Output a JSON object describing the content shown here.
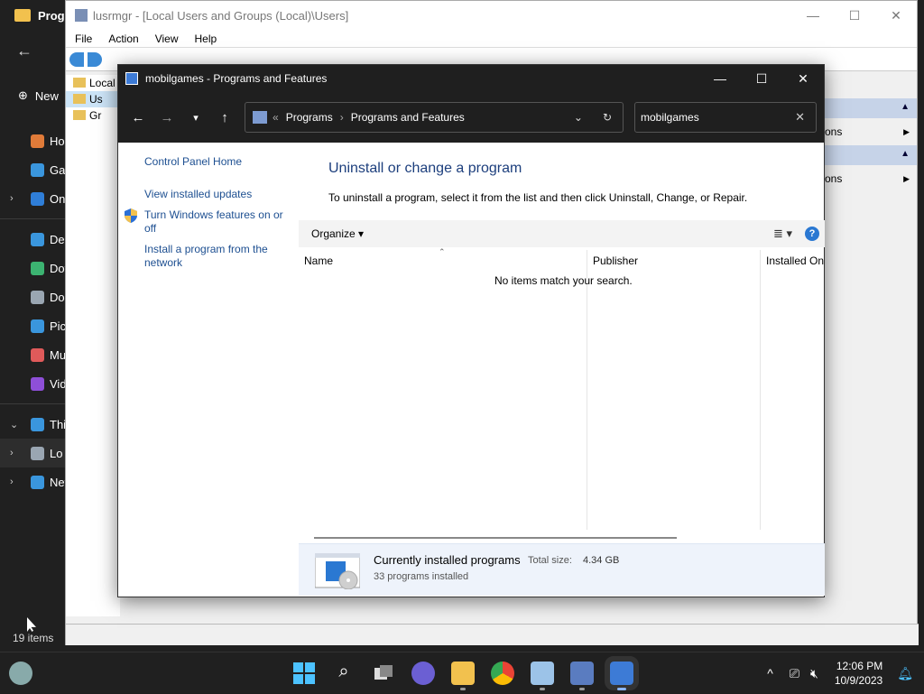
{
  "explorer": {
    "title": "Progr",
    "new_label": "New",
    "nav": [
      {
        "label": "Ho",
        "icon": "home-icon",
        "color": "#e07b39"
      },
      {
        "label": "Gal",
        "icon": "gallery-icon",
        "color": "#3a96dd"
      },
      {
        "label": "On",
        "icon": "onedrive-icon",
        "color": "#2f7ed8",
        "chevron": true
      },
      {
        "label": "Des",
        "icon": "desktop-icon",
        "color": "#3a96dd"
      },
      {
        "label": "Dov",
        "icon": "download-icon",
        "color": "#3cb371"
      },
      {
        "label": "Doc",
        "icon": "documents-icon",
        "color": "#9aa6b2"
      },
      {
        "label": "Pic",
        "icon": "pictures-icon",
        "color": "#3a96dd"
      },
      {
        "label": "Mu",
        "icon": "music-icon",
        "color": "#e05a5a"
      },
      {
        "label": "Vid",
        "icon": "videos-icon",
        "color": "#8e4fd8"
      },
      {
        "label": "Thi",
        "icon": "this-pc-icon",
        "color": "#3a96dd",
        "chevron": "down"
      },
      {
        "label": "Lo",
        "icon": "local-disk-icon",
        "color": "#9aa6b2",
        "chevron": true,
        "selected": true
      },
      {
        "label": "Net",
        "icon": "network-icon",
        "color": "#3a96dd",
        "chevron": true
      }
    ],
    "status": "19 items"
  },
  "lusrmgr": {
    "title": "lusrmgr - [Local Users and Groups (Local)\\Users]",
    "menu": [
      "File",
      "Action",
      "View",
      "Help"
    ],
    "tree": [
      "Local",
      "Us",
      "Gr"
    ],
    "actions": [
      "ons",
      "ons"
    ]
  },
  "pf": {
    "title": "mobilgames - Programs and Features",
    "breadcrumb": [
      "Programs",
      "Programs and Features"
    ],
    "breadcrumb_prefix": "«",
    "search_value": "mobilgames",
    "left_links": [
      "Control Panel Home",
      "View installed updates",
      "Turn Windows features on or off",
      "Install a program from the network"
    ],
    "heading": "Uninstall or change a program",
    "description": "To uninstall a program, select it from the list and then click Uninstall, Change, or Repair.",
    "organize": "Organize",
    "columns": [
      "Name",
      "Publisher",
      "Installed On"
    ],
    "empty_message": "No items match your search.",
    "details": {
      "title": "Currently installed programs",
      "total_size_label": "Total size:",
      "total_size": "4.34 GB",
      "count": "33 programs installed"
    }
  },
  "taskbar": {
    "time": "12:06 PM",
    "date": "10/9/2023"
  }
}
